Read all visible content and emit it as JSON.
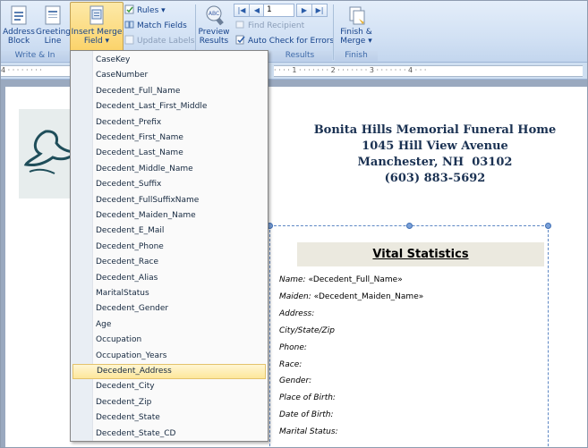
{
  "ribbon": {
    "address_block": [
      "Address",
      "Block"
    ],
    "greeting_line": [
      "Greeting",
      "Line"
    ],
    "insert_merge_field": [
      "Insert Merge",
      "Field ▾"
    ],
    "rules": "Rules ▾",
    "match_fields": "Match Fields",
    "update_labels": "Update Labels",
    "preview_results": [
      "Preview",
      "Results"
    ],
    "record_number": "1",
    "find_recipient": "Find Recipient",
    "auto_check": "Auto Check for Errors",
    "finish_merge": [
      "Finish &",
      "Merge ▾"
    ],
    "groups": {
      "write_insert": "Write & In",
      "results": "Results",
      "finish": "Finish"
    }
  },
  "ruler": {
    "left_ticks": "4 · · · · · · · ·",
    "right_ticks": "· · · · 1 · · · · · · · 2 · · · · · · · 3 · · · · · · · 4 · · ·"
  },
  "dropdown": {
    "items": [
      "CaseKey",
      "CaseNumber",
      "Decedent_Full_Name",
      "Decedent_Last_First_Middle",
      "Decedent_Prefix",
      "Decedent_First_Name",
      "Decedent_Last_Name",
      "Decedent_Middle_Name",
      "Decedent_Suffix",
      "Decedent_FullSuffixName",
      "Decedent_Maiden_Name",
      "Decedent_E_Mail",
      "Decedent_Phone",
      "Decedent_Race",
      "Decedent_Alias",
      "MaritalStatus",
      "Decedent_Gender",
      "Age",
      "Occupation",
      "Occupation_Years",
      "Decedent_Address",
      "Decedent_City",
      "Decedent_Zip",
      "Decedent_State",
      "Decedent_State_CD"
    ],
    "selected_index": 20
  },
  "document": {
    "header_lines": [
      "Bonita Hills Memorial Funeral Home",
      "1045 Hill View Avenue",
      "Manchester, NH  03102",
      "(603) 883-5692"
    ],
    "vital_title": "Vital Statistics",
    "fields": [
      {
        "label": "Name:",
        "value": "«Decedent_Full_Name»"
      },
      {
        "label": "Maiden:",
        "value": "«Decedent_Maiden_Name»"
      },
      {
        "label": "Address:",
        "value": ""
      },
      {
        "label": "City/State/Zip",
        "value": ""
      },
      {
        "label": "Phone:",
        "value": ""
      },
      {
        "label": "Race:",
        "value": ""
      },
      {
        "label": "Gender:",
        "value": ""
      },
      {
        "label": "Place of Birth:",
        "value": ""
      },
      {
        "label": "Date of Birth:",
        "value": ""
      },
      {
        "label": "Marital Status:",
        "value": ""
      }
    ]
  },
  "colors": {
    "ribbon_text": "#15428b",
    "header_text": "#1a3152",
    "selected_item": "#fde79a",
    "logo_bird": "#1f4e5a"
  },
  "icons": [
    "address-block-icon",
    "greeting-line-icon",
    "insert-merge-field-icon",
    "rules-icon",
    "match-fields-icon",
    "update-labels-icon",
    "preview-results-icon",
    "first-record-icon",
    "prev-record-icon",
    "next-record-icon",
    "last-record-icon",
    "find-recipient-icon",
    "auto-check-icon",
    "finish-merge-icon",
    "dove-logo-icon"
  ]
}
